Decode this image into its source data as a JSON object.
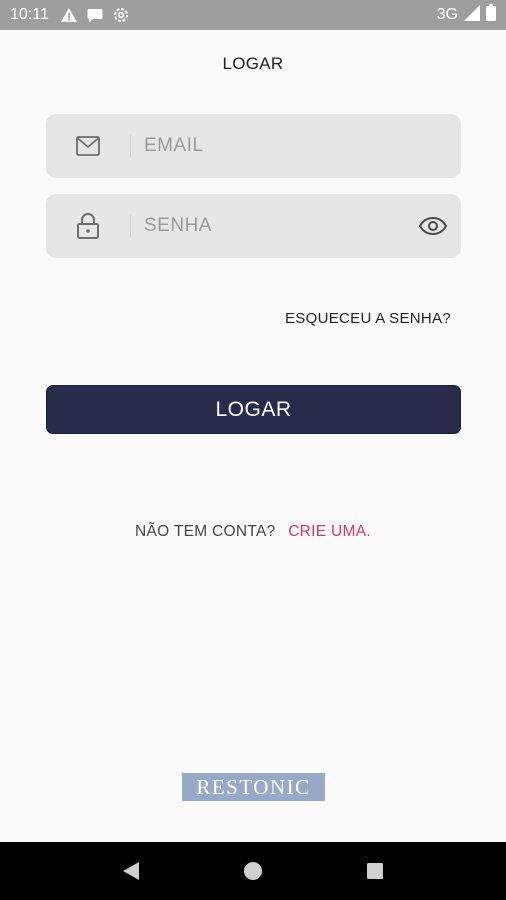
{
  "status_bar": {
    "time": "10:11",
    "network": "3G",
    "icons": [
      "warning-icon",
      "chat-bubble-icon",
      "settings-icon",
      "signal-icon",
      "battery-icon"
    ]
  },
  "page": {
    "title": "LOGAR"
  },
  "form": {
    "email": {
      "placeholder": "EMAIL",
      "value": "",
      "icon": "mail-icon"
    },
    "password": {
      "placeholder": "SENHA",
      "value": "",
      "icon": "lock-icon",
      "toggle_icon": "eye-icon"
    },
    "forgot_label": "ESQUECEU A SENHA?",
    "submit_label": "LOGAR"
  },
  "signup": {
    "question": "NÃO TEM CONTA?",
    "link": "CRIE UMA."
  },
  "brand": {
    "name": "RESTONIC"
  },
  "nav_bar": {
    "buttons": [
      "back-icon",
      "home-icon",
      "recents-icon"
    ]
  },
  "colors": {
    "status_bar_bg": "#9e9e9e",
    "primary_button": "#262c4a",
    "accent_link": "#d7375a",
    "field_bg": "#e6e6e6",
    "brand_bg": "#98a9c8"
  }
}
